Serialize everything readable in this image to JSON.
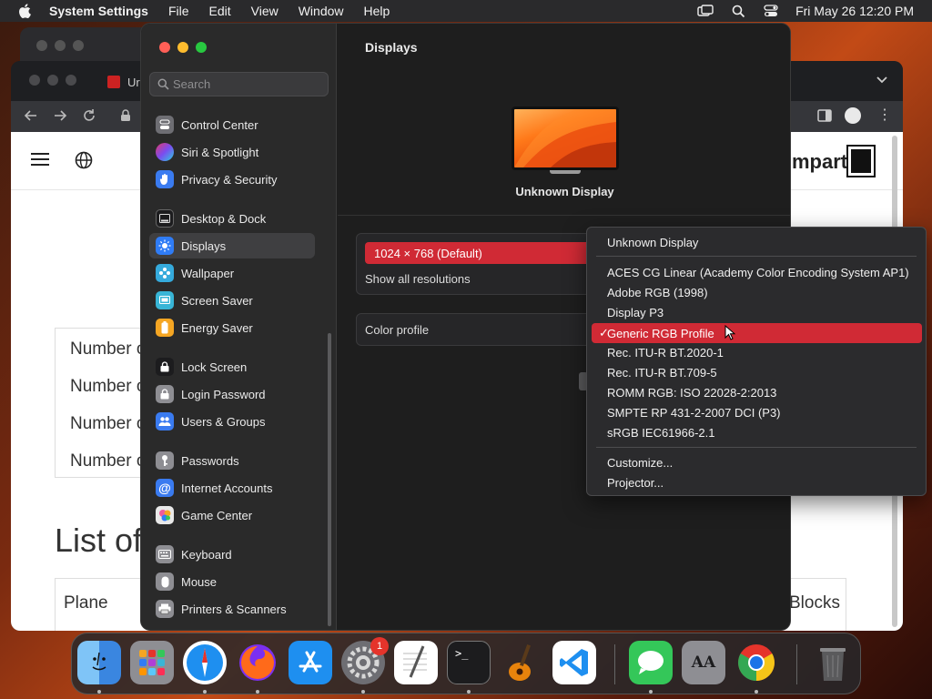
{
  "menubar": {
    "app_name": "System Settings",
    "items": [
      "File",
      "Edit",
      "View",
      "Window",
      "Help"
    ],
    "datetime": "Fri May 26  12:20 PM"
  },
  "browser": {
    "tab_partial": "Ur",
    "logo_text": "mpart",
    "rows": [
      "Number o",
      "Number o",
      "Number o",
      "Number o"
    ],
    "list_title": "List of",
    "col_left": "Plane",
    "col_right": "Blocks"
  },
  "settings": {
    "search_placeholder": "Search",
    "sidebar": [
      {
        "label": "Control Center",
        "icon": "control-center-icon",
        "color": "#6e6e73"
      },
      {
        "label": "Siri & Spotlight",
        "icon": "siri-icon",
        "color": "#b03fd6"
      },
      {
        "label": "Privacy & Security",
        "icon": "hand-icon",
        "color": "#3a7bf0"
      },
      {
        "label": "Desktop & Dock",
        "icon": "dock-icon",
        "color": "#1c1c1e"
      },
      {
        "label": "Displays",
        "icon": "sun-icon",
        "color": "#2f7cf6"
      },
      {
        "label": "Wallpaper",
        "icon": "flower-icon",
        "color": "#35aadc"
      },
      {
        "label": "Screen Saver",
        "icon": "screen-saver-icon",
        "color": "#38b5d6"
      },
      {
        "label": "Energy Saver",
        "icon": "battery-icon",
        "color": "#f5a623"
      },
      {
        "label": "Lock Screen",
        "icon": "lock-icon",
        "color": "#1c1c1e"
      },
      {
        "label": "Login Password",
        "icon": "lock-icon",
        "color": "#8e8e93"
      },
      {
        "label": "Users & Groups",
        "icon": "users-icon",
        "color": "#3a7bf0"
      },
      {
        "label": "Passwords",
        "icon": "key-icon",
        "color": "#8e8e93"
      },
      {
        "label": "Internet Accounts",
        "icon": "at-icon",
        "color": "#3a7bf0"
      },
      {
        "label": "Game Center",
        "icon": "game-center-icon",
        "color": "#e9e9e9"
      },
      {
        "label": "Keyboard",
        "icon": "keyboard-icon",
        "color": "#8e8e93"
      },
      {
        "label": "Mouse",
        "icon": "mouse-icon",
        "color": "#8e8e93"
      },
      {
        "label": "Printers & Scanners",
        "icon": "printer-icon",
        "color": "#8e8e93"
      }
    ],
    "active_item": "Displays",
    "content_title": "Displays",
    "display_name": "Unknown Display",
    "resolution": "1024 × 768 (Default)",
    "show_all": "Show all resolutions",
    "color_profile_label": "Color profile"
  },
  "color_menu": {
    "header": "Unknown Display",
    "profiles": [
      "ACES CG Linear (Academy Color Encoding System AP1)",
      "Adobe RGB (1998)",
      "Display P3",
      "Generic RGB Profile",
      "Rec. ITU-R BT.2020-1",
      "Rec. ITU-R BT.709-5",
      "ROMM RGB: ISO 22028-2:2013",
      "SMPTE RP 431-2-2007 DCI (P3)",
      "sRGB IEC61966-2.1"
    ],
    "selected": "Generic RGB Profile",
    "check": "✓",
    "actions": [
      "Customize...",
      "Projector..."
    ]
  },
  "dock": {
    "apps": [
      "finder",
      "launchpad",
      "safari",
      "firefox",
      "app-store",
      "system-settings",
      "textedit",
      "terminal",
      "garageband",
      "vscode",
      "messages",
      "font-book",
      "chrome",
      "trash"
    ],
    "settings_badge": "1",
    "terminal_prompt": ">_",
    "font_book_text": "AA"
  },
  "colors": {
    "accent_red": "#d02a35",
    "window_bg": "#1e1e1e",
    "sidebar_bg": "#2a2a2a"
  }
}
